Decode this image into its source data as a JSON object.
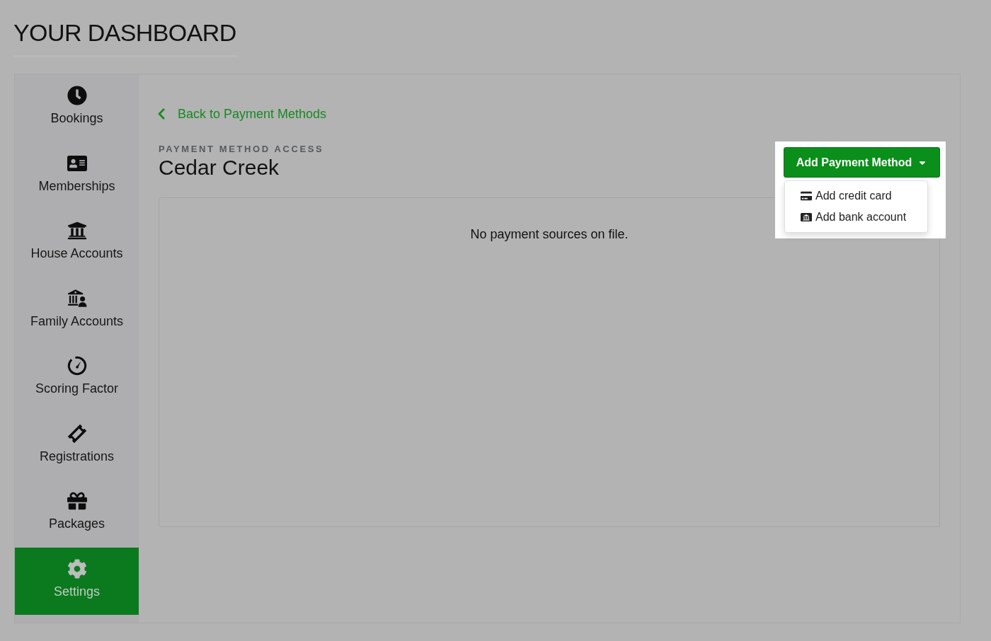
{
  "page_title": "YOUR DASHBOARD",
  "sidebar": {
    "items": [
      {
        "label": "Bookings",
        "selected": false
      },
      {
        "label": "Memberships",
        "selected": false
      },
      {
        "label": "House Accounts",
        "selected": false
      },
      {
        "label": "Family Accounts",
        "selected": false
      },
      {
        "label": "Scoring Factor",
        "selected": false
      },
      {
        "label": "Registrations",
        "selected": false
      },
      {
        "label": "Packages",
        "selected": false
      },
      {
        "label": "Settings",
        "selected": true
      }
    ]
  },
  "back_link": {
    "label": "Back to Payment Methods"
  },
  "header": {
    "eyebrow": "PAYMENT METHOD ACCESS",
    "title": "Cedar Creek"
  },
  "add_payment_button": {
    "label": "Add Payment Method",
    "expanded": true,
    "highlighted": true
  },
  "add_payment_menu": {
    "items": [
      {
        "label": "Add credit card"
      },
      {
        "label": "Add bank account"
      }
    ]
  },
  "payment_sources": {
    "empty_message": "No payment sources on file."
  }
}
